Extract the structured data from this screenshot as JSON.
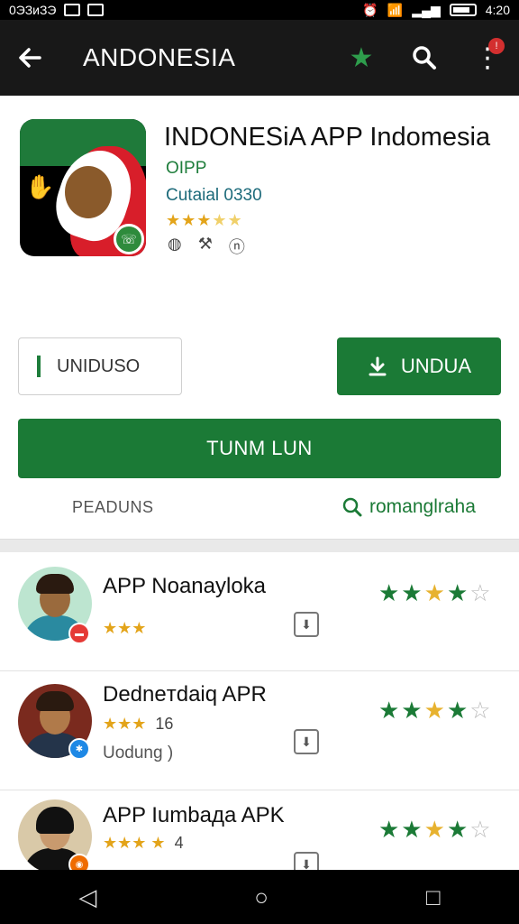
{
  "status_bar": {
    "left_text": "0ЭЗиЗЭ",
    "time": "4:20"
  },
  "app_bar": {
    "back_icon": "arrow-left-icon",
    "title": "ANDONESIA",
    "notification_count": "!"
  },
  "app": {
    "name": "INDONESiA APP Indomesia",
    "developer": "OIPP",
    "category": "Cutaial 0330",
    "rating_stars": 5,
    "rating_filled": 3,
    "icon_badge": "whatsapp-icon"
  },
  "actions": {
    "outline_label": "UNIDUSO",
    "primary_label": "UNDUA",
    "wide_label": "TUNM LUN"
  },
  "tabs": {
    "left_label": "PEADUNS",
    "right_label": "romanglraha"
  },
  "list": [
    {
      "title": "APP Noanayloka",
      "stars_text": "★★★",
      "count": "",
      "subtitle": "",
      "rating": 4,
      "rating_max": 5,
      "badge_color": "#e53935"
    },
    {
      "title": "Dedneтdaiq APR",
      "stars_text": "★★★",
      "count": "16",
      "subtitle": "Uodung )",
      "rating": 4,
      "rating_max": 5,
      "badge_color": "#1e88e5"
    },
    {
      "title": "APP Iumbaдa APK",
      "stars_text": "★★★ ★",
      "count": "4",
      "subtitle": "",
      "rating": 4,
      "rating_max": 5,
      "badge_color": "#ef6c00"
    }
  ],
  "colors": {
    "accent": "#1b7a36",
    "appbar": "#181818",
    "star": "#e3a41a"
  }
}
